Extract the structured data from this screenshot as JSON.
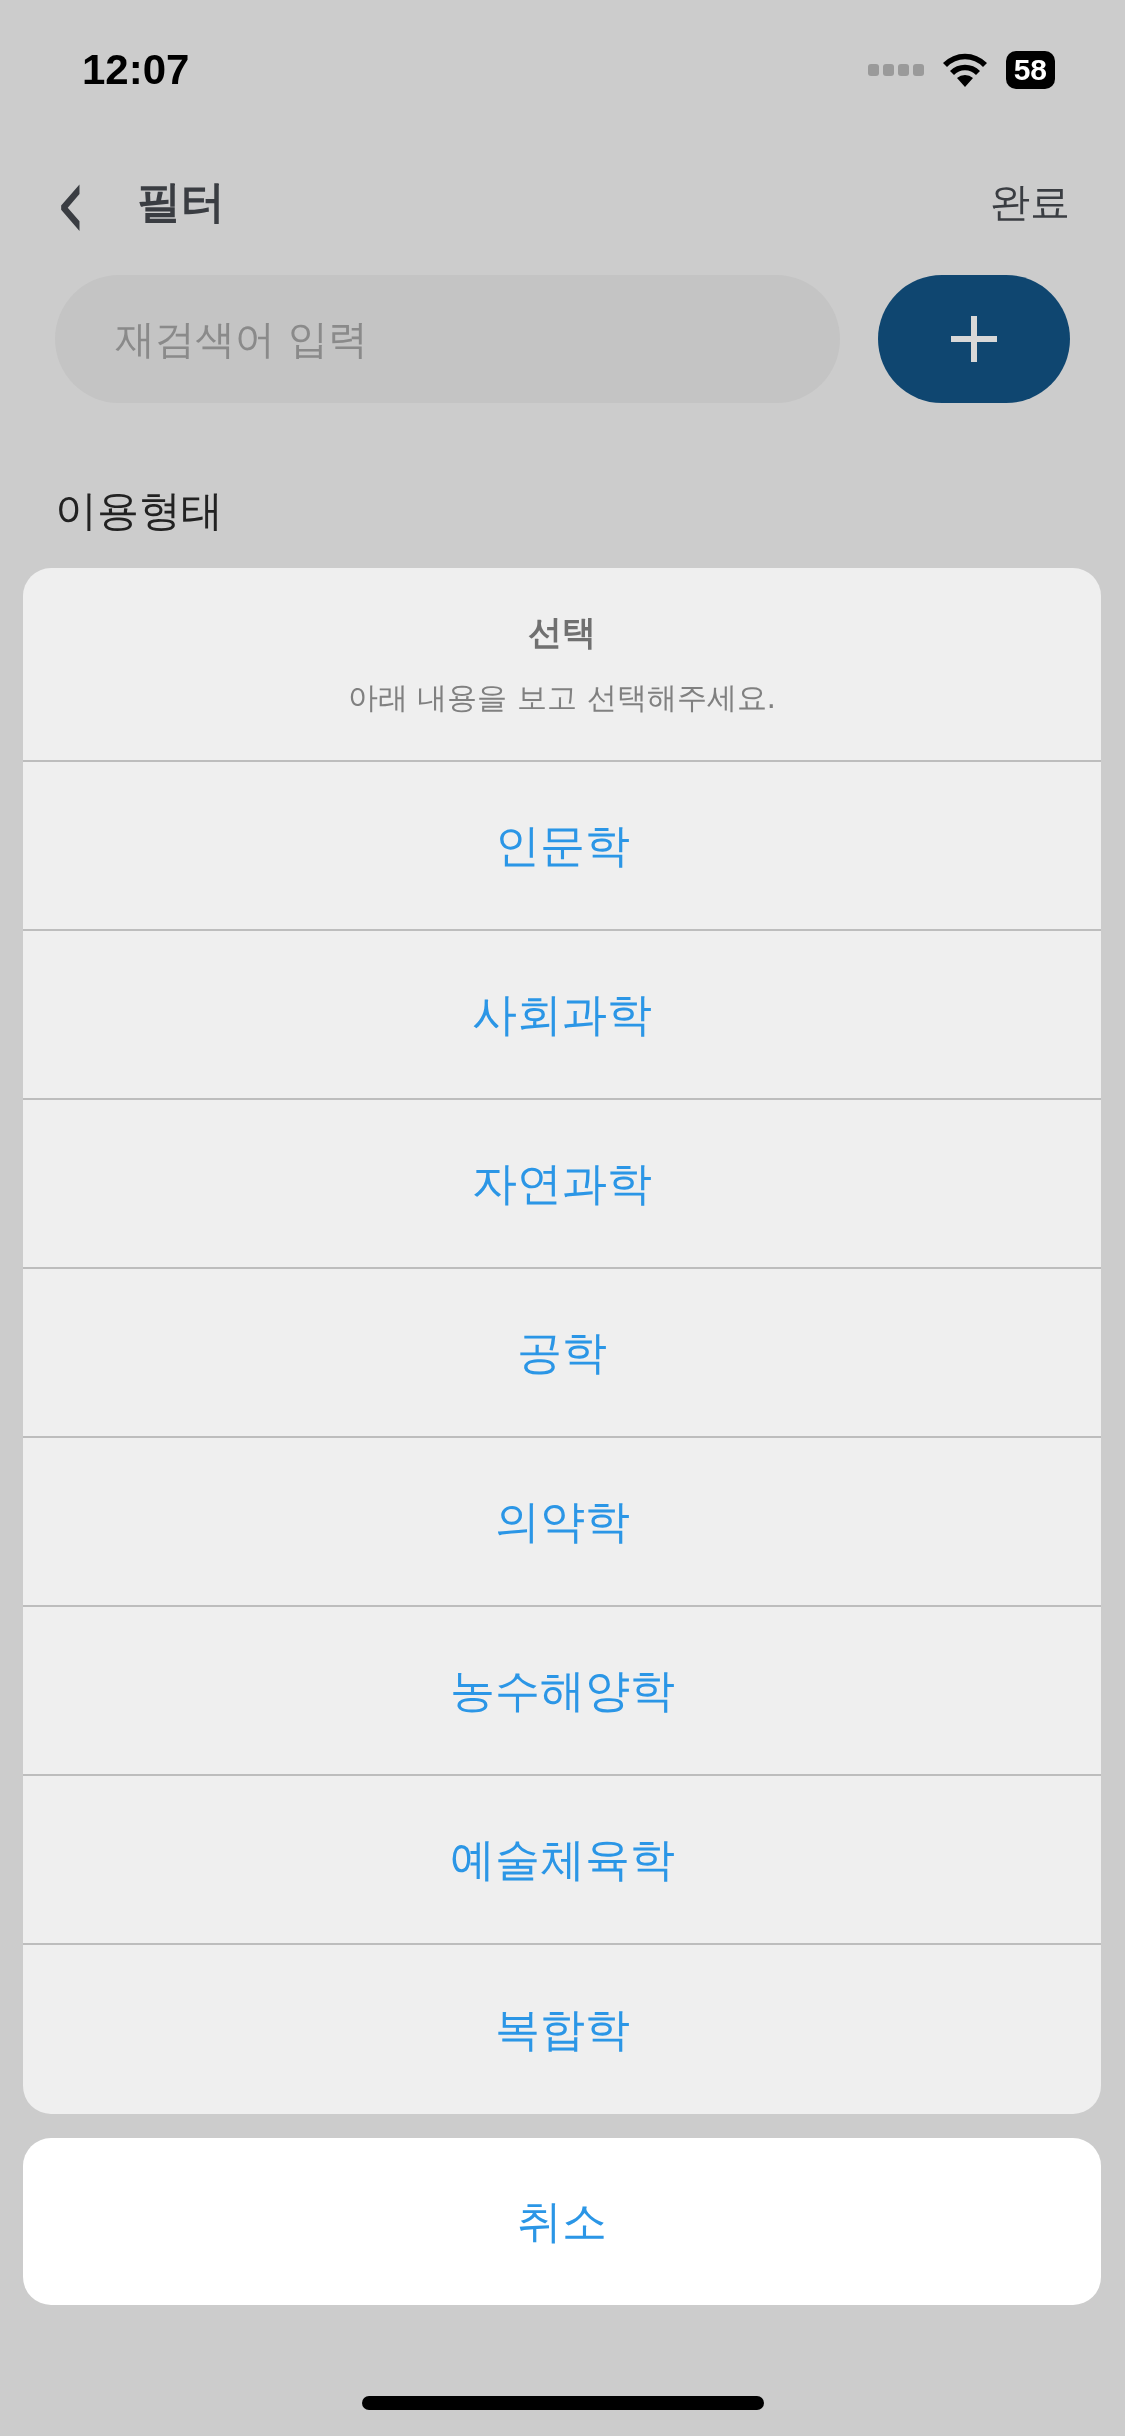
{
  "status_bar": {
    "time": "12:07",
    "battery": "58"
  },
  "header": {
    "back": "‹",
    "title": "필터",
    "done": "완료"
  },
  "search": {
    "placeholder": "재검색어 입력"
  },
  "section": {
    "label": "이용형태"
  },
  "action_sheet": {
    "title": "선택",
    "message": "아래 내용을 보고 선택해주세요.",
    "options": [
      {
        "label": "인문학"
      },
      {
        "label": "사회과학"
      },
      {
        "label": "자연과학"
      },
      {
        "label": "공학"
      },
      {
        "label": "의약학"
      },
      {
        "label": "농수해양학"
      },
      {
        "label": "예술체육학"
      },
      {
        "label": "복합학"
      }
    ],
    "cancel": "취소"
  }
}
